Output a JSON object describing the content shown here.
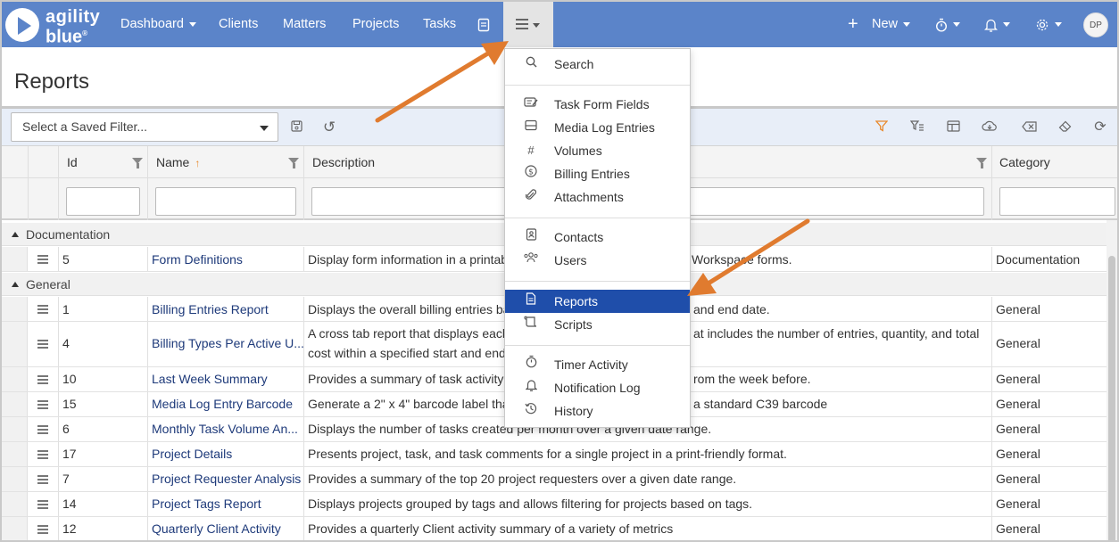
{
  "nav": {
    "logo_line1": "agility",
    "logo_line2": "blue",
    "logo_mark": "®",
    "items": [
      {
        "label": "Dashboard",
        "has_caret": true
      },
      {
        "label": "Clients"
      },
      {
        "label": "Matters"
      },
      {
        "label": "Projects"
      },
      {
        "label": "Tasks"
      }
    ],
    "new_label": "New",
    "avatar_initials": "DP",
    "icons": [
      "document-icon",
      "hamburger-menu-icon",
      "plus-icon",
      "stopwatch-icon",
      "bell-icon",
      "gear-icon"
    ]
  },
  "page": {
    "title": "Reports"
  },
  "toolbar": {
    "saved_filter_placeholder": "Select a Saved Filter...",
    "icons": [
      "save-icon",
      "undo-icon",
      "filter-icon",
      "clear-filter-icon",
      "columns-icon",
      "download-icon",
      "clear-icon",
      "eraser-icon",
      "refresh-icon"
    ]
  },
  "grid": {
    "columns": {
      "id": "Id",
      "name": "Name",
      "sort_indicator": "↑",
      "description": "Description",
      "category": "Category"
    },
    "groups": [
      {
        "label": "Documentation",
        "rows": [
          {
            "id": "5",
            "name": "Form Definitions",
            "desc_left": "Display form information in a printab",
            "desc_right": "Workspace forms.",
            "category": "Documentation"
          }
        ]
      },
      {
        "label": "General",
        "rows": [
          {
            "id": "1",
            "name": "Billing Entries Report",
            "desc_left": "Displays the overall billing entries ba",
            "desc_right": "and end date.",
            "category": "General"
          },
          {
            "id": "4",
            "name": "Billing Types Per Active U...",
            "desc_left": "A cross tab report that displays each",
            "desc_left2": "cost within a specified start and end",
            "desc_right": "at includes the number of entries, quantity, and total",
            "category": "General"
          },
          {
            "id": "10",
            "name": "Last Week Summary",
            "desc_left": "Provides a summary of task activity f",
            "desc_right": "rom the week before.",
            "category": "General"
          },
          {
            "id": "15",
            "name": "Media Log Entry Barcode",
            "desc_left": "Generate a 2\" x 4\" barcode label that",
            "desc_right": "a standard C39 barcode",
            "category": "General"
          },
          {
            "id": "6",
            "name": "Monthly Task Volume An...",
            "desc_left": "Displays the number of tasks created per month over a given date range.",
            "desc_right": "",
            "category": "General"
          },
          {
            "id": "17",
            "name": "Project Details",
            "desc_left": "Presents project, task, and task comments for a single project in a print-friendly format.",
            "desc_right": "",
            "category": "General"
          },
          {
            "id": "7",
            "name": "Project Requester Analysis",
            "desc_left": "Provides a summary of the top 20 project requesters over a given date range.",
            "desc_right": "",
            "category": "General"
          },
          {
            "id": "14",
            "name": "Project Tags Report",
            "desc_left": "Displays projects grouped by tags and allows filtering for projects based on tags.",
            "desc_right": "",
            "category": "General"
          },
          {
            "id": "12",
            "name": "Quarterly Client Activity",
            "desc_left": "Provides a quarterly Client activity summary of a variety of metrics",
            "desc_right": "",
            "category": "General"
          }
        ]
      }
    ]
  },
  "menu": {
    "sections": [
      [
        {
          "label": "Search",
          "icon": "search-icon",
          "glyph": "⌕"
        }
      ],
      [
        {
          "label": "Task Form Fields",
          "icon": "form-icon",
          "glyph": "✎"
        },
        {
          "label": "Media Log Entries",
          "icon": "media-log-icon",
          "glyph": "▭"
        },
        {
          "label": "Volumes",
          "icon": "hash-icon",
          "glyph": "#"
        },
        {
          "label": "Billing Entries",
          "icon": "dollar-icon",
          "glyph": "$"
        },
        {
          "label": "Attachments",
          "icon": "paperclip-icon",
          "glyph": "⌇"
        }
      ],
      [
        {
          "label": "Contacts",
          "icon": "contact-card-icon",
          "glyph": "☐"
        },
        {
          "label": "Users",
          "icon": "users-icon",
          "glyph": "☺"
        }
      ],
      [
        {
          "label": "Reports",
          "icon": "report-document-icon",
          "glyph": "▤",
          "active": true
        },
        {
          "label": "Scripts",
          "icon": "scripts-icon",
          "glyph": "⎘"
        }
      ],
      [
        {
          "label": "Timer Activity",
          "icon": "stopwatch-icon",
          "glyph": "◷"
        },
        {
          "label": "Notification Log",
          "icon": "bell-icon",
          "glyph": "△"
        },
        {
          "label": "History",
          "icon": "history-icon",
          "glyph": "↺"
        }
      ]
    ]
  },
  "colors": {
    "navbar": "#5b84c9",
    "active_menu": "#1f4eaa",
    "annotation_arrow": "#e07b2f",
    "link_text": "#1e3a7a"
  }
}
